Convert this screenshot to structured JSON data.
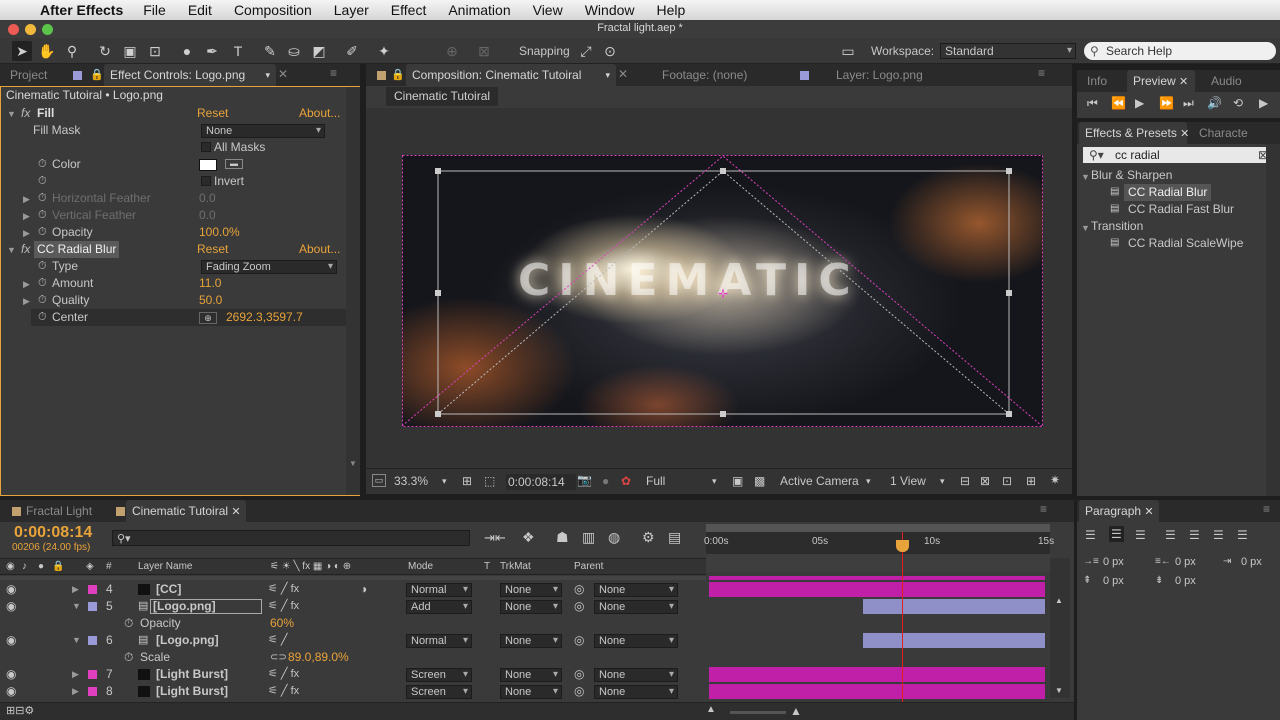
{
  "menubar": {
    "app_name": "After Effects",
    "items": [
      "File",
      "Edit",
      "Composition",
      "Layer",
      "Effect",
      "Animation",
      "View",
      "Window",
      "Help"
    ]
  },
  "titlebar": {
    "title": "Fractal light.aep *"
  },
  "toolbar": {
    "snapping_label": "Snapping",
    "workspace_label": "Workspace:",
    "workspace_value": "Standard",
    "search_placeholder": "Search Help"
  },
  "left_panel": {
    "tabs": [
      "Project",
      "Effect Controls: Logo.png"
    ],
    "header": "Cinematic Tutoiral • Logo.png",
    "effects": [
      {
        "name": "Fill",
        "reset": "Reset",
        "about": "About..."
      },
      {
        "name": "CC Radial Blur",
        "reset": "Reset",
        "about": "About..."
      }
    ],
    "fill": {
      "fill_mask_label": "Fill Mask",
      "fill_mask_value": "None",
      "all_masks_label": "All Masks",
      "color_label": "Color",
      "invert_label": "Invert",
      "h_feather_label": "Horizontal Feather",
      "h_feather_value": "0.0",
      "v_feather_label": "Vertical Feather",
      "v_feather_value": "0.0",
      "opacity_label": "Opacity",
      "opacity_value": "100.0%"
    },
    "radial": {
      "type_label": "Type",
      "type_value": "Fading Zoom",
      "amount_label": "Amount",
      "amount_value": "11.0",
      "quality_label": "Quality",
      "quality_value": "50.0",
      "center_label": "Center",
      "center_value": "2692.3,3597.7"
    }
  },
  "comp_panel": {
    "tabs": [
      "Composition: Cinematic Tutoiral",
      "Footage: (none)",
      "Layer: Logo.png"
    ],
    "sub_tab": "Cinematic Tutoiral",
    "title_text": "CINEMATIC",
    "zoom": "33.3%",
    "timecode": "0:00:08:14",
    "resolution": "Full",
    "camera": "Active Camera",
    "views": "1 View"
  },
  "right_panel": {
    "top_tabs": [
      "Info",
      "Preview",
      "Audio"
    ],
    "fx_tabs": [
      "Effects & Presets",
      "Characte"
    ],
    "search_value": "cc radial",
    "categories": [
      {
        "name": "Blur & Sharpen",
        "items": [
          "CC Radial Blur",
          "CC Radial Fast Blur"
        ]
      },
      {
        "name": "Transition",
        "items": [
          "CC Radial ScaleWipe"
        ]
      }
    ],
    "paragraph_tab": "Paragraph",
    "para_values": [
      "0 px",
      "0 px",
      "0 px",
      "0 px",
      "0 px"
    ]
  },
  "timeline": {
    "tabs": [
      "Fractal Light",
      "Cinematic Tutoiral"
    ],
    "timecode": "0:00:08:14",
    "frames": "00206 (24.00 fps)",
    "columns": {
      "layer_name": "Layer Name",
      "mode": "Mode",
      "t": "T",
      "trkmat": "TrkMat",
      "parent": "Parent"
    },
    "ruler": [
      "0:00s",
      "05s",
      "10s",
      "15s"
    ],
    "layers": [
      {
        "num": "4",
        "name": "[CC]",
        "mode": "Normal",
        "trkmat": "None",
        "parent": "None",
        "color": "#e040c0"
      },
      {
        "num": "5",
        "name": "[Logo.png]",
        "mode": "Add",
        "trkmat": "None",
        "parent": "None",
        "color": "#9a9ad8"
      },
      {
        "num": "6",
        "name": "[Logo.png]",
        "mode": "Normal",
        "trkmat": "None",
        "parent": "None",
        "color": "#9a9ad8"
      },
      {
        "num": "7",
        "name": "[Light Burst]",
        "mode": "Screen",
        "trkmat": "None",
        "parent": "None",
        "color": "#e040c0"
      },
      {
        "num": "8",
        "name": "[Light Burst]",
        "mode": "Screen",
        "trkmat": "None",
        "parent": "None",
        "color": "#e040c0"
      }
    ],
    "props": [
      {
        "name": "Opacity",
        "value": "60%"
      },
      {
        "name": "Scale",
        "value": "89.0,89.0%"
      }
    ]
  },
  "colors": {
    "accent": "#e8a33a",
    "layer_pink": "#c020a8",
    "layer_lilac": "#9090c8"
  }
}
